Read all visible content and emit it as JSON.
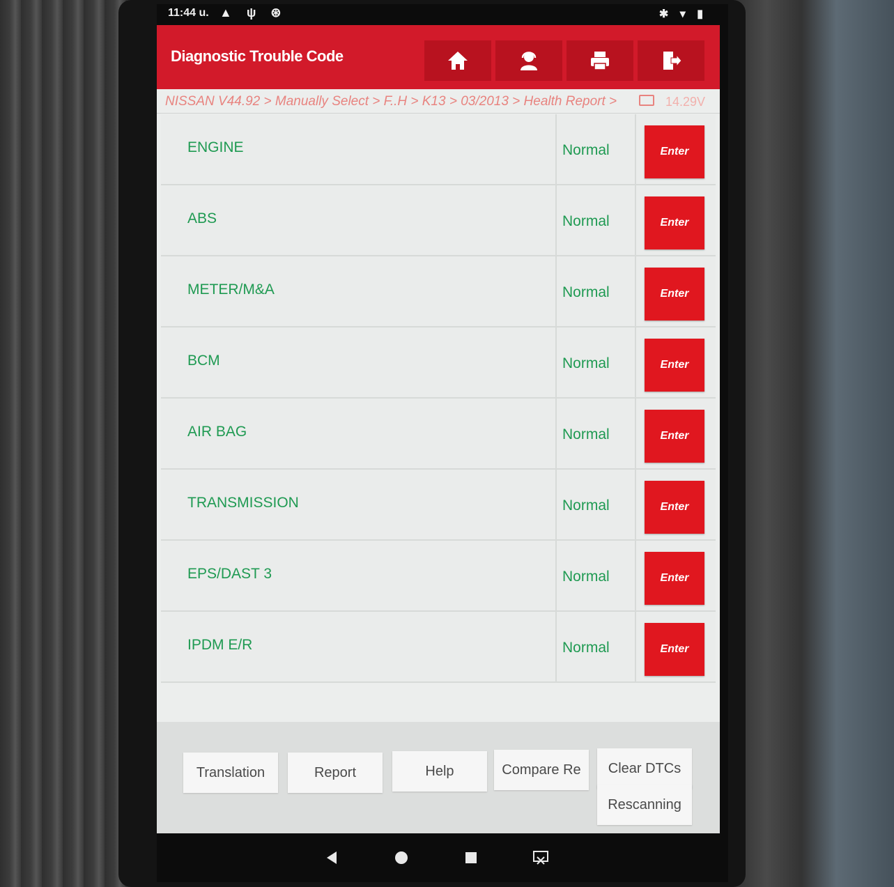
{
  "status_bar": {
    "time": "11:44 u.",
    "left_icons": "▲ ψ ⊛",
    "right_icons": "✱ ▾ ▮"
  },
  "header": {
    "title": "Diagnostic Trouble Code",
    "buttons": [
      {
        "name": "home",
        "icon": "home-icon"
      },
      {
        "name": "support",
        "icon": "person-icon"
      },
      {
        "name": "print",
        "icon": "printer-icon"
      },
      {
        "name": "exit",
        "icon": "exit-icon"
      }
    ]
  },
  "breadcrumb": {
    "path": "NISSAN V44.92 > Manually Select > F..H > K13 > 03/2013 > Health Report >",
    "voltage": "14.29V"
  },
  "systems": [
    {
      "name": "ENGINE",
      "status": "Normal",
      "action": "Enter"
    },
    {
      "name": "ABS",
      "status": "Normal",
      "action": "Enter"
    },
    {
      "name": "METER/M&A",
      "status": "Normal",
      "action": "Enter"
    },
    {
      "name": "BCM",
      "status": "Normal",
      "action": "Enter"
    },
    {
      "name": "AIR BAG",
      "status": "Normal",
      "action": "Enter"
    },
    {
      "name": "TRANSMISSION",
      "status": "Normal",
      "action": "Enter"
    },
    {
      "name": "EPS/DAST 3",
      "status": "Normal",
      "action": "Enter"
    },
    {
      "name": "IPDM E/R",
      "status": "Normal",
      "action": "Enter"
    }
  ],
  "bottom_buttons": {
    "translation": "Translation",
    "report": "Report",
    "help": "Help",
    "compare": "Compare Re",
    "clear_dtcs": "Clear DTCs",
    "rescanning": "Rescanning"
  },
  "nav": [
    "back",
    "home",
    "recents",
    "screenshot"
  ],
  "colors": {
    "header_red": "#d21a2a",
    "enter_red": "#e0171f",
    "status_green": "#1f9a52",
    "breadcrumb_pink": "#e8837f"
  }
}
